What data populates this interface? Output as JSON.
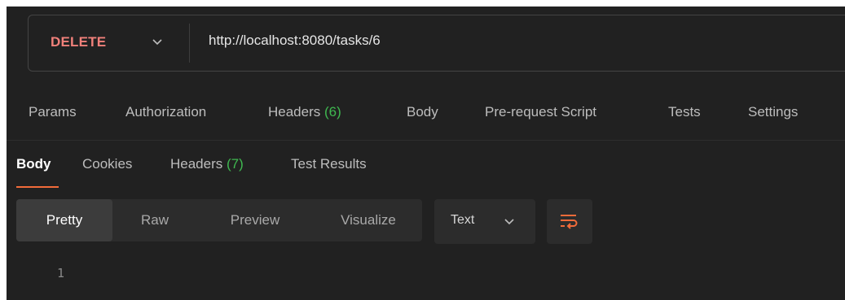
{
  "request": {
    "method": "DELETE",
    "url": "http://localhost:8080/tasks/6"
  },
  "request_tabs": [
    {
      "label": "Params"
    },
    {
      "label": "Authorization"
    },
    {
      "label": "Headers",
      "count": "(6)"
    },
    {
      "label": "Body"
    },
    {
      "label": "Pre-request Script"
    },
    {
      "label": "Tests"
    },
    {
      "label": "Settings"
    }
  ],
  "response_tabs": [
    {
      "label": "Body"
    },
    {
      "label": "Cookies"
    },
    {
      "label": "Headers",
      "count": "(7)"
    },
    {
      "label": "Test Results"
    }
  ],
  "format_buttons": [
    {
      "label": "Pretty"
    },
    {
      "label": "Raw"
    },
    {
      "label": "Preview"
    },
    {
      "label": "Visualize"
    }
  ],
  "language_select": {
    "value": "Text"
  },
  "editor": {
    "line_numbers": [
      "1"
    ]
  },
  "colors": {
    "background": "#212121",
    "method_delete": "#f0807a",
    "count_green": "#3fb950",
    "active_underline": "#f26b3a"
  },
  "icons": {
    "method_dropdown": "chevron-down-icon",
    "language_dropdown": "chevron-down-icon",
    "wrap": "wrap-lines-icon"
  }
}
